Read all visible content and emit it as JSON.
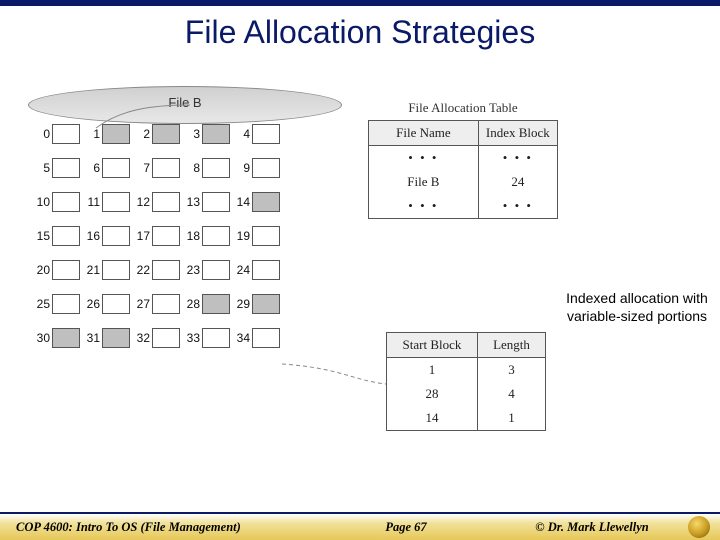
{
  "title": "File Allocation Strategies",
  "caption": "Indexed allocation with variable-sized portions",
  "cylinder_label": "File B",
  "filled_blocks": [
    1,
    2,
    3,
    14,
    28,
    29,
    30,
    31
  ],
  "file_allocation_table": {
    "title": "File Allocation Table",
    "headers": [
      "File Name",
      "Index Block"
    ],
    "rows": [
      [
        "• • •",
        "• • •"
      ],
      [
        "File B",
        "24"
      ],
      [
        "• • •",
        "• • •"
      ]
    ]
  },
  "index_block_table": {
    "headers": [
      "Start Block",
      "Length"
    ],
    "rows": [
      [
        "1",
        "3"
      ],
      [
        "28",
        "4"
      ],
      [
        "14",
        "1"
      ]
    ]
  },
  "blocks_per_row": 5,
  "num_rows": 7,
  "footer": {
    "course": "COP 4600: Intro To OS  (File Management)",
    "page": "Page 67",
    "author": "© Dr. Mark Llewellyn"
  }
}
